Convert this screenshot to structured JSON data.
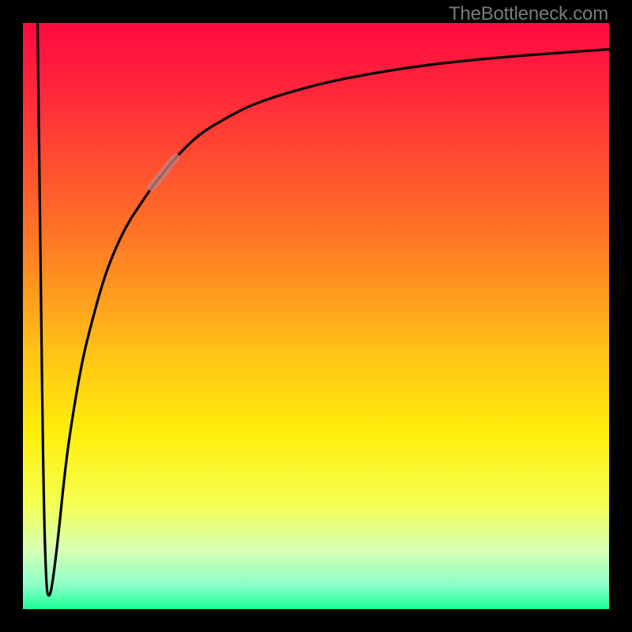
{
  "watermark": "TheBottleneck.com",
  "colors": {
    "black": "#000000",
    "curve": "#000000",
    "highlight": "#c77d7d"
  },
  "chart_data": {
    "type": "line",
    "title": "",
    "xlabel": "",
    "ylabel": "",
    "xlim": [
      0,
      100
    ],
    "ylim": [
      0,
      100
    ],
    "grid": false,
    "legend": false,
    "description": "Rainbow vertical gradient background (red top → green bottom) with a black curve. The curve starts at top-left, drops sharply to near-zero around x≈4, then rises steeply and asymptotically approaches the top toward the right edge. A short pale section highlights the curve around x≈22–26.",
    "gradient_stops": [
      {
        "offset": 0.0,
        "color": "#ff0a40"
      },
      {
        "offset": 0.12,
        "color": "#ff283a"
      },
      {
        "offset": 0.28,
        "color": "#ff5a2c"
      },
      {
        "offset": 0.42,
        "color": "#ff8a22"
      },
      {
        "offset": 0.56,
        "color": "#ffc216"
      },
      {
        "offset": 0.7,
        "color": "#ffee0a"
      },
      {
        "offset": 0.82,
        "color": "#f5ff52"
      },
      {
        "offset": 0.9,
        "color": "#d6ffb4"
      },
      {
        "offset": 0.96,
        "color": "#8affc8"
      },
      {
        "offset": 1.0,
        "color": "#1aff94"
      }
    ],
    "series": [
      {
        "name": "curve",
        "x": [
          2.5,
          3.0,
          3.5,
          4.0,
          4.5,
          5.0,
          6.0,
          7.0,
          8.0,
          10,
          12,
          14,
          16,
          18,
          20,
          22,
          24,
          26,
          30,
          35,
          40,
          50,
          60,
          70,
          80,
          90,
          100
        ],
        "y": [
          100,
          60,
          20,
          3,
          2,
          4,
          12,
          22,
          30,
          42,
          50,
          57,
          62,
          66,
          69,
          72,
          74.5,
          77,
          81,
          84,
          86.5,
          89.5,
          91.5,
          93,
          94,
          94.8,
          95.5
        ]
      }
    ],
    "highlight_segment": {
      "x_start": 21,
      "x_end": 27
    }
  }
}
